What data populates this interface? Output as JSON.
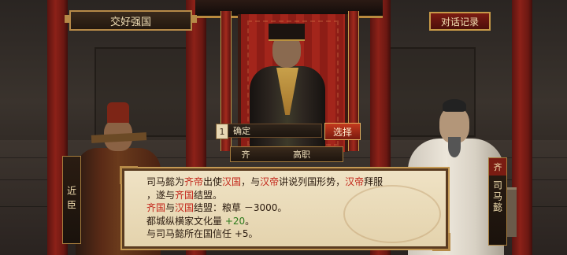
{
  "header": {
    "title": "交好强国",
    "log_button": "对话记录"
  },
  "choice": {
    "number": "1",
    "option": "确定",
    "select_button": "选择"
  },
  "speaker": {
    "state": "齐",
    "office": "高职"
  },
  "left_character": {
    "label": "近臣"
  },
  "right_character": {
    "state": "齐",
    "name": "司马懿"
  },
  "dialog": {
    "line1": {
      "a": "司马懿为",
      "b": "齐帝",
      "c": "出使",
      "d": "汉国",
      "e": "，与",
      "f": "汉帝",
      "g": "讲说列国形势，",
      "h": "汉帝",
      "i": "拜服"
    },
    "line2": {
      "a": "，遂与",
      "b": "齐国",
      "c": "结盟。"
    },
    "line3": {
      "a": "齐国",
      "b": "与",
      "c": "汉国",
      "d": "结盟：粮草 －3000。"
    },
    "line4": {
      "a": "都城纵横家文化量 ",
      "b": "+20",
      "c": "。"
    },
    "line5": "与司马懿所在国信任 +5。"
  },
  "colors": {
    "highlight_red": "#c3261a",
    "highlight_green": "#2a7a1a",
    "gold_border": "#b68a48"
  }
}
